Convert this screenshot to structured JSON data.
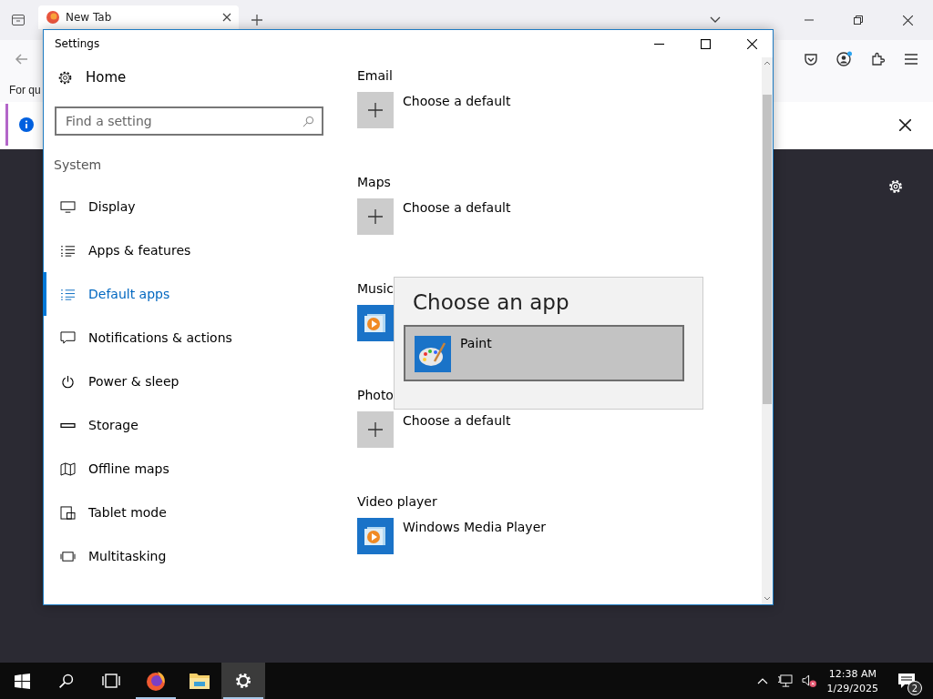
{
  "browser": {
    "tab": {
      "title": "New Tab"
    },
    "bookmarks_text": "For qu"
  },
  "settings": {
    "title": "Settings",
    "home": "Home",
    "search": {
      "placeholder": "Find a setting"
    },
    "section": "System",
    "nav": [
      {
        "label": "Display",
        "selected": false
      },
      {
        "label": "Apps & features",
        "selected": false
      },
      {
        "label": "Default apps",
        "selected": true
      },
      {
        "label": "Notifications & actions",
        "selected": false
      },
      {
        "label": "Power & sleep",
        "selected": false
      },
      {
        "label": "Storage",
        "selected": false
      },
      {
        "label": "Offline maps",
        "selected": false
      },
      {
        "label": "Tablet mode",
        "selected": false
      },
      {
        "label": "Multitasking",
        "selected": false
      }
    ],
    "categories": [
      {
        "heading": "Email",
        "kind": "plus",
        "app": "Choose a default"
      },
      {
        "heading": "Maps",
        "kind": "plus",
        "app": "Choose a default"
      },
      {
        "heading": "Music",
        "kind": "media"
      },
      {
        "heading": "Photo",
        "kind": "plus",
        "app": "Choose a default"
      },
      {
        "heading": "Video player",
        "kind": "media",
        "app": "Windows Media Player"
      }
    ]
  },
  "popup": {
    "title": "Choose an app",
    "items": [
      {
        "name": "Paint",
        "selected": true
      }
    ]
  },
  "taskbar": {
    "apps": [
      {
        "kind": "firefox",
        "selected": false
      },
      {
        "kind": "explorer",
        "selected": false
      },
      {
        "kind": "settings",
        "selected": true
      }
    ],
    "time": "12:38 AM",
    "date": "1/29/2025",
    "notifications": "2"
  }
}
